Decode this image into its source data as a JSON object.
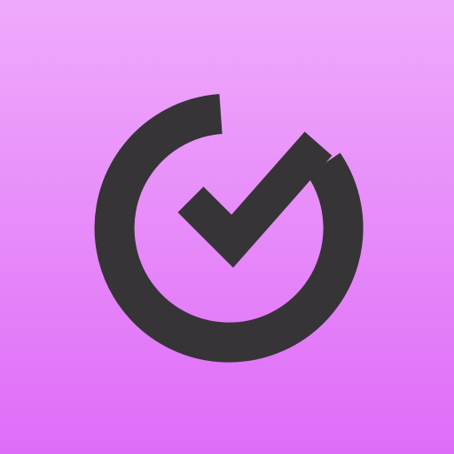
{
  "app_icon": {
    "icon_name": "check-circle-logo",
    "colors": {
      "background_top": "#efaafc",
      "background_bottom": "#df6cf8",
      "glyph": "#363436"
    }
  }
}
